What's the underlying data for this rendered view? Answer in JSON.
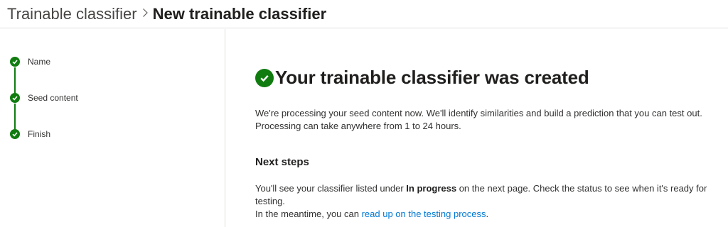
{
  "breadcrumb": {
    "parent": "Trainable classifier",
    "separator": ">",
    "current": "New trainable classifier"
  },
  "steps": [
    {
      "label": "Name",
      "status": "complete"
    },
    {
      "label": "Seed content",
      "status": "complete"
    },
    {
      "label": "Finish",
      "status": "complete"
    }
  ],
  "main": {
    "title": "Your trainable classifier was created",
    "description": "We're processing your seed content now. We'll identify similarities and build a prediction that you can test out. Processing can take anywhere from 1 to 24 hours.",
    "next_steps_heading": "Next steps",
    "next_steps_text_1": "You'll see your classifier listed under ",
    "next_steps_bold": "In progress",
    "next_steps_text_2": " on the next page. Check the status to see when it's ready for testing.",
    "meantime_text": "In the meantime, you can ",
    "meantime_link": "read up on the testing process",
    "meantime_end": "."
  },
  "colors": {
    "success": "#107c10",
    "link": "#0078d4",
    "divider": "#e1dfdd"
  },
  "icons": {
    "step": "checkmark-circle-icon",
    "title": "checkmark-circle-icon"
  }
}
